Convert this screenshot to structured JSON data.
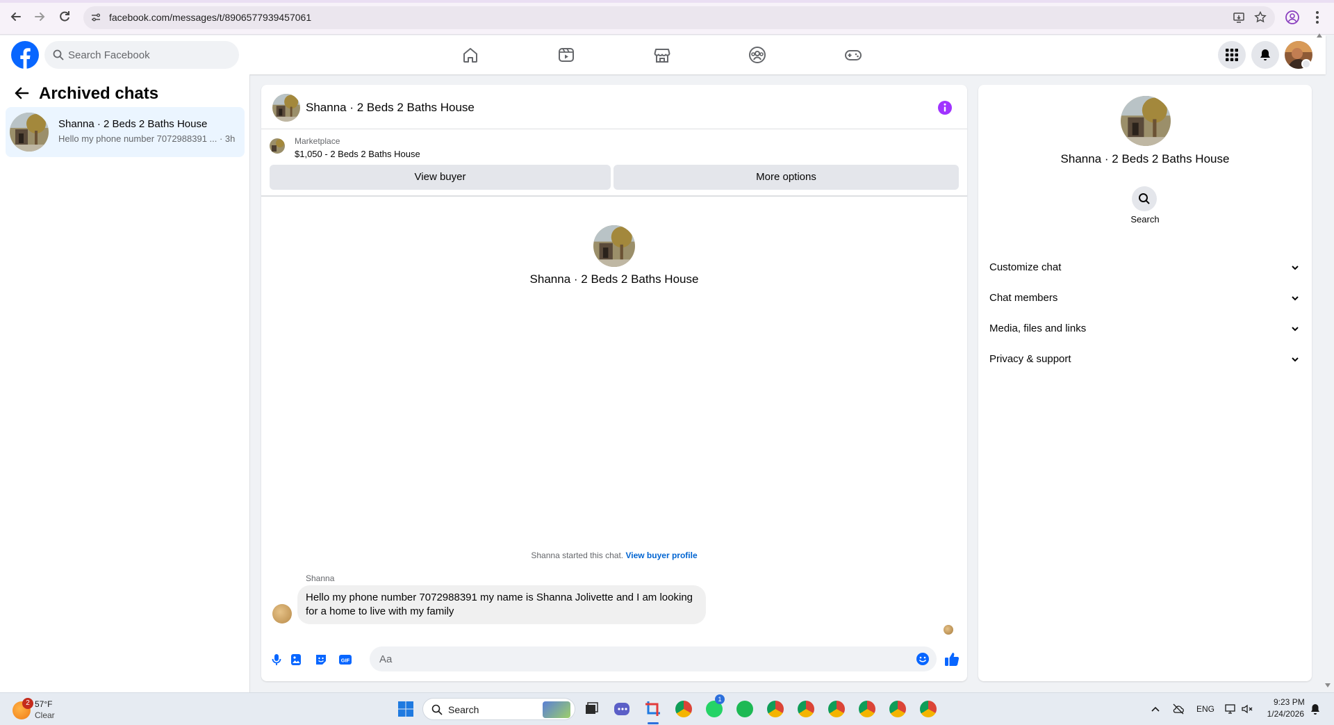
{
  "browser": {
    "url": "facebook.com/messages/t/8906577939457061"
  },
  "fb": {
    "search_placeholder": "Search Facebook"
  },
  "left": {
    "title": "Archived chats",
    "chats": [
      {
        "name": "Shanna · 2 Beds 2 Baths House",
        "preview": "Hello my phone number 7072988391 ... · 3h"
      }
    ]
  },
  "conversation": {
    "title": "Shanna · 2 Beds 2 Baths House",
    "marketplace_label": "Marketplace",
    "listing": "$1,050 - 2 Beds 2 Baths House",
    "view_buyer_label": "View buyer",
    "more_options_label": "More options",
    "intro_name": "Shanna · 2 Beds 2 Baths House",
    "started_text": "Shanna started this chat.",
    "view_profile_link": "View buyer profile",
    "sender": "Shanna",
    "message": "Hello my phone number 7072988391 my name is Shanna Jolivette and I am looking for a home to live with my family",
    "composer_placeholder": "Aa"
  },
  "info": {
    "name": "Shanna · 2 Beds 2 Baths House",
    "search_label": "Search",
    "sections": [
      "Customize chat",
      "Chat members",
      "Media, files and links",
      "Privacy & support"
    ]
  },
  "taskbar": {
    "weather_temp": "57°F",
    "weather_cond": "Clear",
    "weather_badge": "2",
    "search_label": "Search",
    "whatsapp_badge": "1",
    "language": "ENG",
    "time": "9:23 PM",
    "date": "1/24/2026"
  },
  "colors": {
    "fb_blue": "#0866ff",
    "selected_chat_bg": "#ebf5ff",
    "info_purple": "#a033ff",
    "link_blue": "#0064d1"
  }
}
